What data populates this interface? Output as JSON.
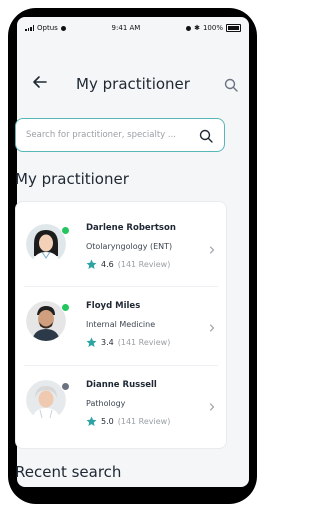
{
  "statusbar": {
    "carrier": "Optus",
    "time": "9:41 AM",
    "battery": "100%"
  },
  "navbar": {
    "title": "My practitioner"
  },
  "search": {
    "placeholder": "Search for practitioner, specialty ..."
  },
  "section_title": "My practitioner",
  "practitioners": [
    {
      "name": "Darlene Robertson",
      "specialty": "Otolaryngology (ENT)",
      "rating": "4.6",
      "reviews": "(141 Review)",
      "status_color": "#22c55e"
    },
    {
      "name": "Floyd Miles",
      "specialty": "Internal Medicine",
      "rating": "3.4",
      "reviews": "(141 Review)",
      "status_color": "#22c55e"
    },
    {
      "name": "Dianne Russell",
      "specialty": "Pathology",
      "rating": "5.0",
      "reviews": "(141 Review)",
      "status_color": "#6b7280"
    }
  ],
  "recent_title": "Recent search",
  "colors": {
    "accent": "#58b7b6",
    "star": "#2ea3a3",
    "online": "#22c55e",
    "offline": "#6b7280"
  }
}
